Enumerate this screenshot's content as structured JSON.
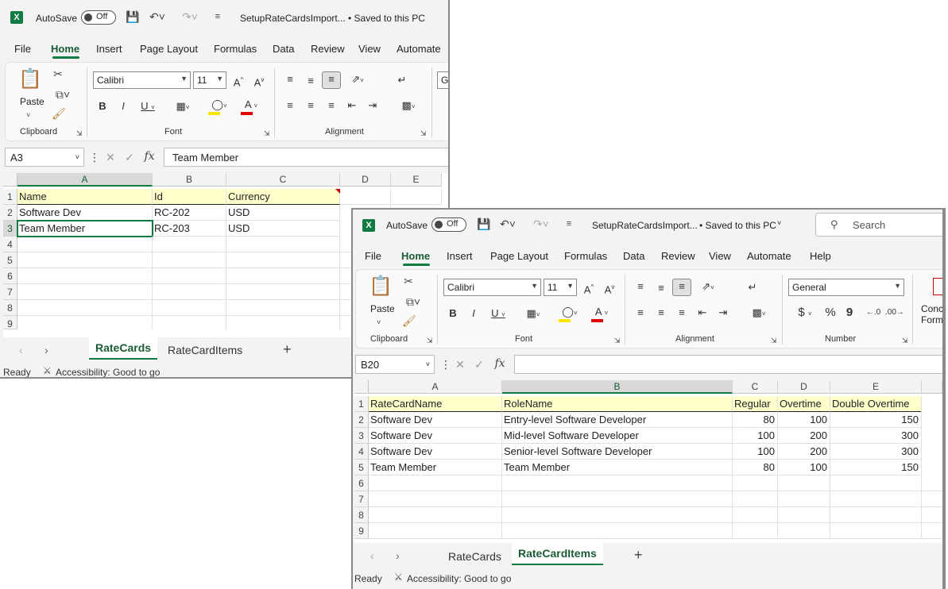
{
  "windows": [
    {
      "title_file": "SetupRateCardsImport...",
      "save_status": "• Saved to this PC",
      "autosave_label": "AutoSave",
      "autosave_state": "Off",
      "menu": [
        "File",
        "Home",
        "Insert",
        "Page Layout",
        "Formulas",
        "Data",
        "Review",
        "View",
        "Automate"
      ],
      "ribbon": {
        "paste": "Paste",
        "font_name": "Calibri",
        "font_size": "11",
        "groups": [
          "Clipboard",
          "Font",
          "Alignment"
        ],
        "number_format_partial": "G"
      },
      "name_box": "A3",
      "formula": "Team Member",
      "columns": [
        "A",
        "B",
        "C",
        "D",
        "E"
      ],
      "rows": [
        "1",
        "2",
        "3",
        "4",
        "5",
        "6",
        "7",
        "8",
        "9"
      ],
      "cells": [
        [
          "Name",
          "Id",
          "Currency"
        ],
        [
          "Software Dev",
          "RC-202",
          "USD"
        ],
        [
          "Team Member",
          "RC-203",
          "USD"
        ]
      ],
      "tabs": [
        "RateCards",
        "RateCardItems"
      ],
      "active_tab": "RateCards",
      "status": "Ready",
      "accessibility": "Accessibility: Good to go"
    },
    {
      "title_file": "SetupRateCardsImport...",
      "save_status": "• Saved to this PC",
      "autosave_label": "AutoSave",
      "autosave_state": "Off",
      "search_placeholder": "Search",
      "menu": [
        "File",
        "Home",
        "Insert",
        "Page Layout",
        "Formulas",
        "Data",
        "Review",
        "View",
        "Automate",
        "Help"
      ],
      "ribbon": {
        "paste": "Paste",
        "font_name": "Calibri",
        "font_size": "11",
        "number_format": "General",
        "groups": [
          "Clipboard",
          "Font",
          "Alignment",
          "Number"
        ],
        "cond_format_partial": "Conc Form"
      },
      "name_box": "B20",
      "formula": "",
      "columns": [
        "A",
        "B",
        "C",
        "D",
        "E"
      ],
      "rows": [
        "1",
        "2",
        "3",
        "4",
        "5",
        "6",
        "7",
        "8",
        "9"
      ],
      "cells": [
        [
          "RateCardName",
          "RoleName",
          "Regular",
          "Overtime",
          "Double Overtime"
        ],
        [
          "Software Dev",
          "Entry-level Software Developer",
          "80",
          "100",
          "150"
        ],
        [
          "Software Dev",
          "Mid-level Software Developer",
          "100",
          "200",
          "300"
        ],
        [
          "Software Dev",
          "Senior-level Software Developer",
          "100",
          "200",
          "300"
        ],
        [
          "Team Member",
          "Team Member",
          "80",
          "100",
          "150"
        ]
      ],
      "tabs": [
        "RateCards",
        "RateCardItems"
      ],
      "active_tab": "RateCardItems",
      "status": "Ready",
      "accessibility": "Accessibility: Good to go"
    }
  ],
  "colors": {
    "excel_green": "#107c41",
    "header_fill": "#ffffcc",
    "comment_red": "#c00000"
  }
}
